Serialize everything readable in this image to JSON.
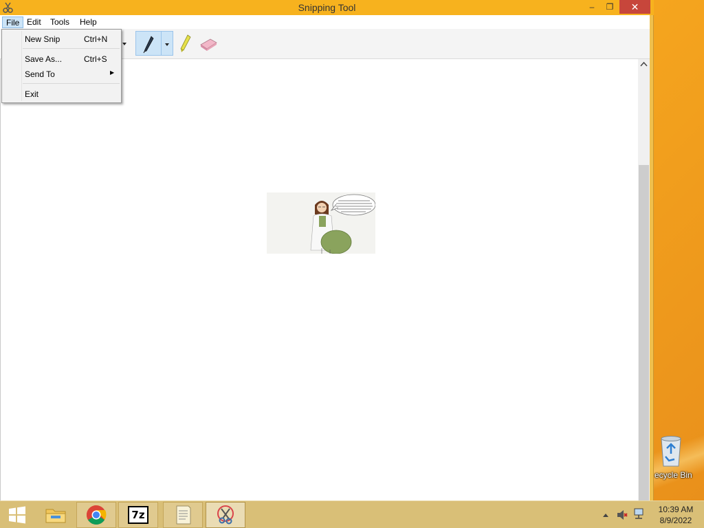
{
  "window": {
    "title": "Snipping Tool",
    "controls": {
      "minimize": "–",
      "maximize": "❐",
      "close": "✕"
    }
  },
  "menubar": {
    "items": [
      {
        "label": "File",
        "active": true
      },
      {
        "label": "Edit",
        "active": false
      },
      {
        "label": "Tools",
        "active": false
      },
      {
        "label": "Help",
        "active": false
      }
    ]
  },
  "file_menu": {
    "items": [
      {
        "label": "New Snip",
        "shortcut": "Ctrl+N"
      },
      {
        "label": "Save As...",
        "shortcut": "Ctrl+S"
      },
      {
        "label": "Send To",
        "submenu_arrow": "▶"
      },
      {
        "label": "Exit"
      }
    ]
  },
  "toolbar": {
    "tools": [
      {
        "icon": "pen-icon",
        "selected": true
      },
      {
        "icon": "highlighter-icon",
        "selected": false
      },
      {
        "icon": "eraser-icon",
        "selected": false
      }
    ]
  },
  "snip_image": {
    "bubble_text": "Oh! The clinical trial is designed to a ratio for the placebo to the intended target. But we of a dangerous pest. The scientists say the pregnancy should. It's closer to what they"
  },
  "desktop": {
    "recycle_bin_label": "ecycle Bin"
  },
  "taskbar": {
    "apps": [
      {
        "name": "File Explorer",
        "icon": "folder-icon"
      },
      {
        "name": "Google Chrome",
        "icon": "chrome-icon"
      },
      {
        "name": "7-Zip",
        "icon": "7zip-icon",
        "glyph": "7z"
      },
      {
        "name": "Notepad",
        "icon": "notepad-icon"
      },
      {
        "name": "Snipping Tool",
        "icon": "scissors-icon",
        "active": true
      }
    ],
    "clock": {
      "time": "10:39 AM",
      "date": "8/9/2022"
    },
    "colors": {
      "taskbar": "#d9bf77",
      "desktop": "#f7b21a",
      "close": "#c7463b",
      "highlight": "#cce4f7"
    }
  }
}
